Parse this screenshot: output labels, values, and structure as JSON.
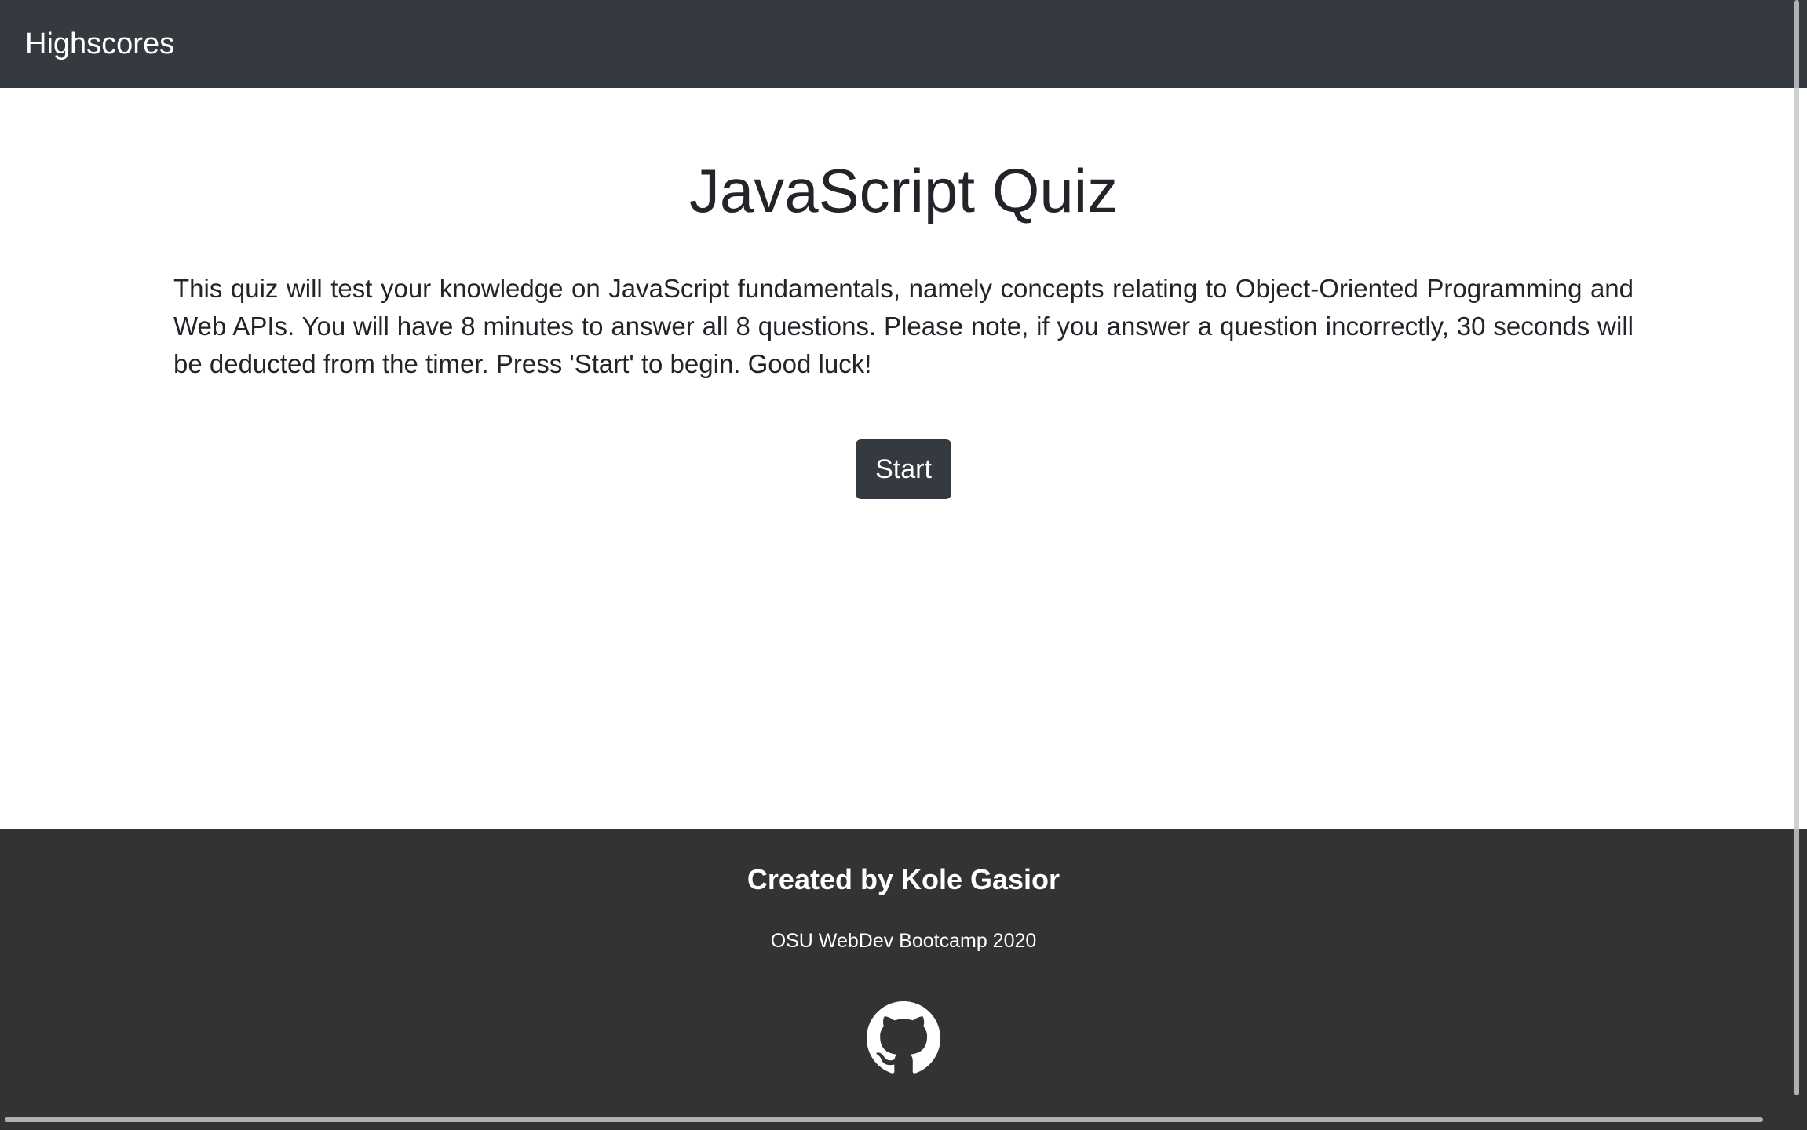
{
  "nav": {
    "highscores_label": "Highscores"
  },
  "main": {
    "title": "JavaScript Quiz",
    "description": "This quiz will test your knowledge on JavaScript fundamentals, namely concepts relating to Object-Oriented Programming and Web APIs. You will have 8 minutes to answer all 8 questions. Please note, if you answer a question incorrectly, 30 seconds will be deducted from the timer. Press 'Start' to begin. Good luck!",
    "start_label": "Start"
  },
  "footer": {
    "title": "Created by Kole Gasior",
    "subtitle": "OSU WebDev Bootcamp 2020",
    "github_icon": "github-icon"
  },
  "colors": {
    "navbar_bg": "#343a40",
    "footer_bg": "#333333",
    "button_bg": "#343a40",
    "text_dark": "#212529",
    "text_light": "#ffffff"
  }
}
